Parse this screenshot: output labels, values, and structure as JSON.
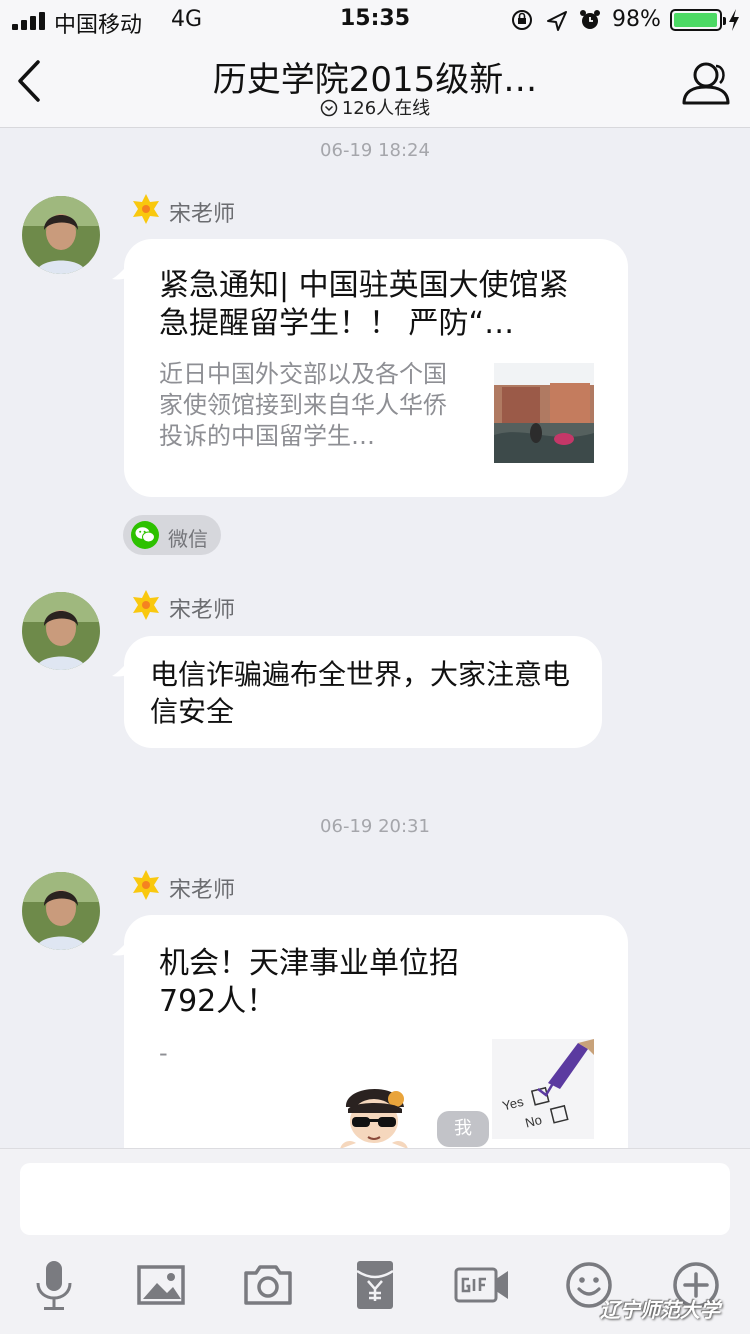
{
  "status_bar": {
    "carrier": "中国移动",
    "network": "4G",
    "time": "15:35",
    "battery_percent": "98%",
    "battery_level": 0.98,
    "battery_color": "#4cd964"
  },
  "nav": {
    "title": "历史学院2015级新…",
    "online": "126人在线"
  },
  "messages": {
    "ts1": "06-19 18:24",
    "ts2": "06-19 20:31",
    "msg1": {
      "sender": "宋老师",
      "title": "紧急通知| 中国驻英国大使馆紧急提醒留学生！！ 严防“…",
      "desc": "近日中国外交部以及各个国家使领馆接到来自华人华侨投诉的中国留学生…",
      "source": "微信"
    },
    "msg2": {
      "sender": "宋老师",
      "text": "电信诈骗遍布全世界，大家注意电信安全"
    },
    "msg3": {
      "sender": "宋老师",
      "title": "机会！天津事业单位招792人！",
      "dash": "-",
      "me_label": "我",
      "thumb_yes": "Yes",
      "thumb_no": "No"
    }
  },
  "icons": {
    "toolbar": [
      "microphone-icon",
      "image-icon",
      "camera-icon",
      "red-packet-icon",
      "gif-icon",
      "emoji-icon",
      "plus-icon"
    ]
  },
  "watermark": "辽宁师范大学"
}
